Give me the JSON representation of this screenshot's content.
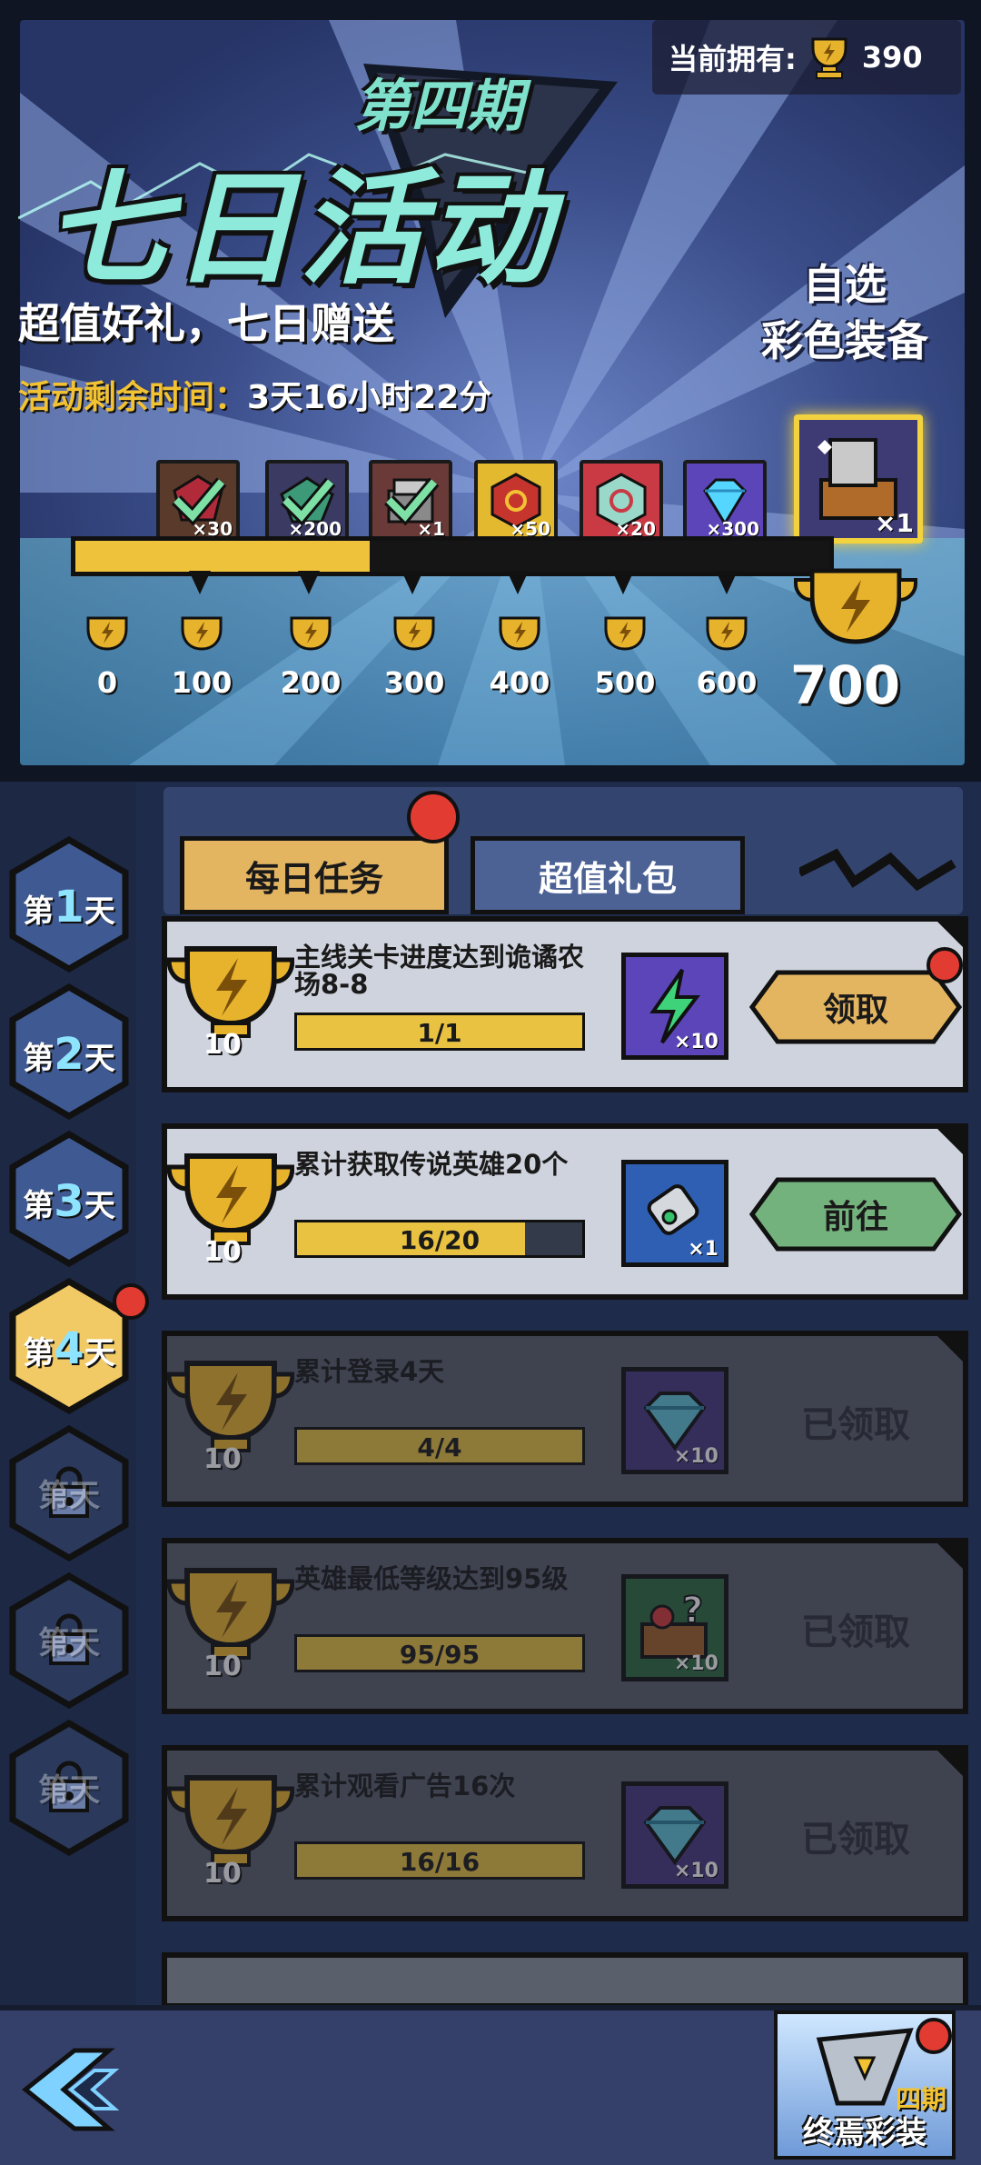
{
  "header": {
    "period": "第四期",
    "event_title": "七日活动",
    "owned_label": "当前拥有:",
    "owned_value": "390",
    "slogan": "超值好礼，七日赠送",
    "remaining_label": "活动剩余时间：",
    "remaining_value": "3天16小时22分",
    "pick_line1": "自选",
    "pick_line2": "彩色装备"
  },
  "rewards": [
    {
      "icon": "ruby-gem-icon",
      "qty": "×30",
      "claimed": true
    },
    {
      "icon": "emerald-gem-icon",
      "qty": "×200",
      "claimed": true
    },
    {
      "icon": "scroll-chest-icon",
      "qty": "×1",
      "claimed": true
    },
    {
      "icon": "red-rune-icon",
      "qty": "×50",
      "claimed": false
    },
    {
      "icon": "spiral-rune-icon",
      "qty": "×20",
      "claimed": false
    },
    {
      "icon": "diamond-icon",
      "qty": "×300",
      "claimed": false
    },
    {
      "icon": "equipment-chest-icon",
      "qty": "×1",
      "claimed": false
    }
  ],
  "milestones": [
    "0",
    "100",
    "200",
    "300",
    "400",
    "500",
    "600"
  ],
  "final_milestone": "700",
  "progress_fraction": 0.39,
  "days": [
    {
      "prefix": "第",
      "num": "1",
      "suffix": "天",
      "state": "normal"
    },
    {
      "prefix": "第",
      "num": "2",
      "suffix": "天",
      "state": "normal"
    },
    {
      "prefix": "第",
      "num": "3",
      "suffix": "天",
      "state": "normal"
    },
    {
      "prefix": "第",
      "num": "4",
      "suffix": "天",
      "state": "active"
    },
    {
      "prefix": "第",
      "num": "5",
      "suffix": "天",
      "state": "locked"
    },
    {
      "prefix": "第",
      "num": "6",
      "suffix": "天",
      "state": "locked"
    },
    {
      "prefix": "第",
      "num": "7",
      "suffix": "天",
      "state": "locked"
    }
  ],
  "tabs": {
    "daily": "每日任务",
    "pack": "超值礼包"
  },
  "tasks": [
    {
      "desc": "主线关卡进度达到诡谲农场8-8",
      "progress": "1/1",
      "fill": 1.0,
      "points": "10",
      "item_icon": "lightning-icon",
      "item_qty": "×10",
      "action": "领取",
      "state": "claim"
    },
    {
      "desc": "累计获取传说英雄20个",
      "progress": "16/20",
      "fill": 0.8,
      "points": "10",
      "item_icon": "scroll-icon",
      "item_qty": "×1",
      "action": "前往",
      "state": "go"
    },
    {
      "desc": "累计登录4天",
      "progress": "4/4",
      "fill": 1.0,
      "points": "10",
      "item_icon": "diamond-icon",
      "item_qty": "×10",
      "action": "已领取",
      "state": "done"
    },
    {
      "desc": "英雄最低等级达到95级",
      "progress": "95/95",
      "fill": 1.0,
      "points": "10",
      "item_icon": "mystery-chest-icon",
      "item_qty": "×10",
      "action": "已领取",
      "state": "done"
    },
    {
      "desc": "累计观看广告16次",
      "progress": "16/16",
      "fill": 1.0,
      "points": "10",
      "item_icon": "diamond-icon",
      "item_qty": "×10",
      "action": "已领取",
      "state": "done"
    }
  ],
  "bottom": {
    "skin_label": "终焉彩装",
    "skin_tag": "四期"
  },
  "colors": {
    "gold": "#efc23b",
    "claim_button": "#e4b561",
    "go_button": "#74b27d",
    "badge_red": "#e23b32"
  }
}
